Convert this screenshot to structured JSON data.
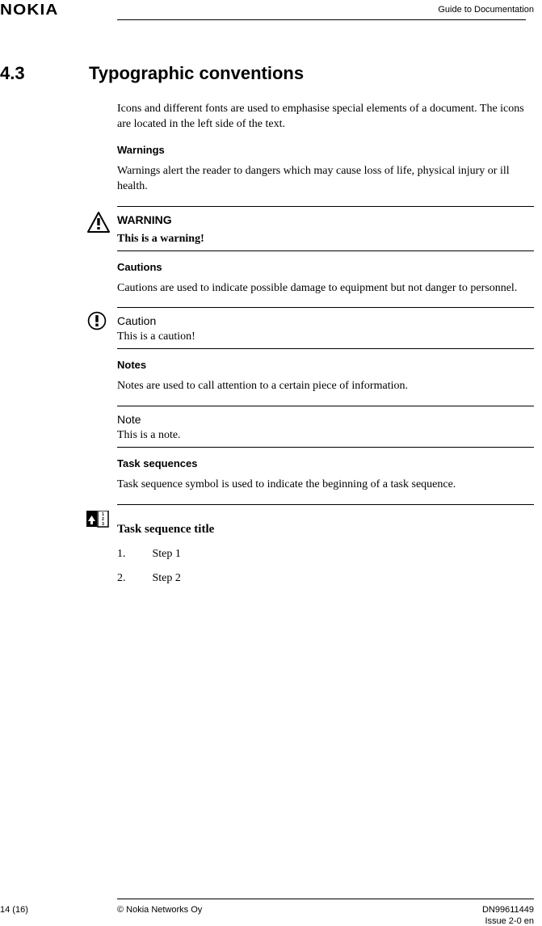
{
  "header": {
    "logo": "NOKIA",
    "guide_label": "Guide to Documentation"
  },
  "section": {
    "number": "4.3",
    "title": "Typographic conventions",
    "intro": "Icons and different fonts are used to emphasise special elements of a document. The icons are located in the left side of the text."
  },
  "warnings": {
    "heading": "Warnings",
    "desc": "Warnings alert the reader to dangers which may cause loss of life, physical injury or ill health.",
    "callout_heading": "WARNING",
    "callout_text": "This is a warning!"
  },
  "cautions": {
    "heading": "Cautions",
    "desc": "Cautions are used to indicate possible damage to equipment but not danger to personnel.",
    "callout_heading": "Caution",
    "callout_text": "This is a caution!"
  },
  "notes": {
    "heading": "Notes",
    "desc": "Notes are used to call attention to a certain piece of information.",
    "callout_heading": "Note",
    "callout_text": "This is a note."
  },
  "tasks": {
    "heading": "Task sequences",
    "desc": "Task sequence symbol is used to indicate the beginning of a task sequence.",
    "title": "Task sequence title",
    "steps": [
      "Step 1",
      "Step 2"
    ],
    "step_labels": [
      "1.",
      "2."
    ]
  },
  "footer": {
    "page": "14 (16)",
    "copyright": "© Nokia Networks Oy",
    "doc_id": "DN99611449",
    "issue": "Issue 2-0 en"
  }
}
